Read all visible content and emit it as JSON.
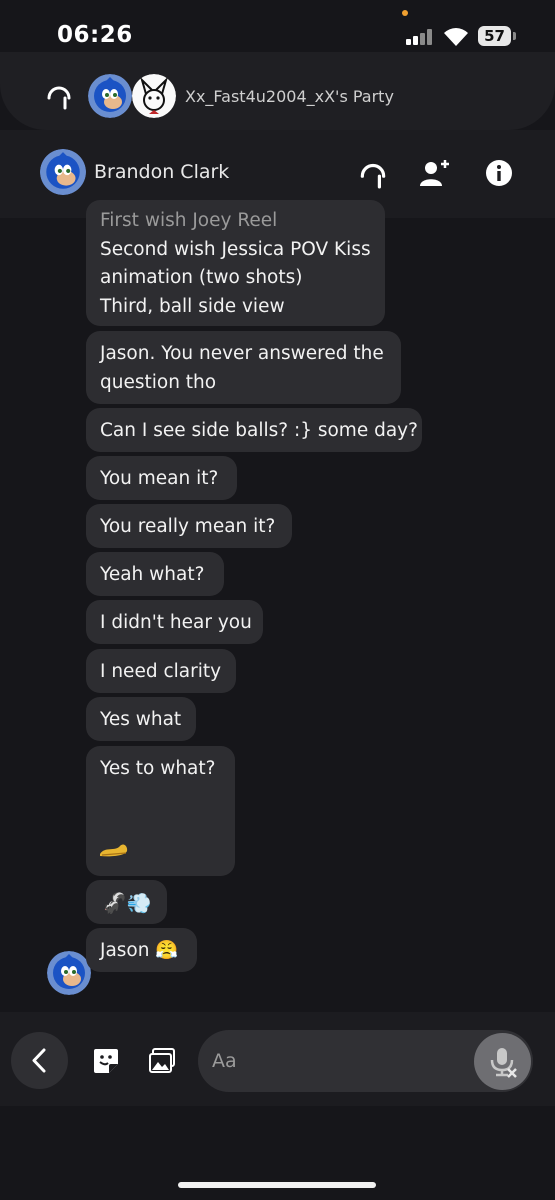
{
  "status_bar": {
    "time": "06:26",
    "battery": "57"
  },
  "party": {
    "title": "Xx_Fast4u2004_xX's Party"
  },
  "chat_header": {
    "name": "Brandon Clark"
  },
  "messages": [
    {
      "lines": [
        "First wish Joey Reel",
        "Second wish Jessica POV Kiss",
        "animation (two shots)",
        "Third, ball side view"
      ]
    },
    {
      "lines": [
        "Jason. You never answered the",
        "question tho"
      ]
    },
    {
      "text": "Can I see side balls? :} some day?"
    },
    {
      "text": "You mean it?"
    },
    {
      "text": "You really mean it?"
    },
    {
      "text": "Yeah what?"
    },
    {
      "text": "I didn't hear you"
    },
    {
      "text": "I need clarity"
    },
    {
      "text": "Yes what"
    },
    {
      "text": "Yes to what?"
    },
    {
      "emoji": "🦨💨"
    },
    {
      "text": "Jason 😤"
    }
  ],
  "composer": {
    "placeholder": "Aa"
  },
  "colors": {
    "background": "#16161a",
    "bubble": "#2d2d31",
    "accent_dot": "#f0a030"
  }
}
